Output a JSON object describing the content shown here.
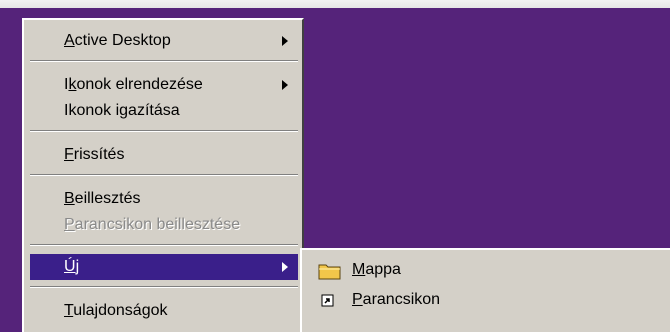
{
  "colors": {
    "desktop": "#55237a",
    "menu_bg": "#d4d0c8",
    "selection": "#3a1f8a",
    "disabled_text": "#8a8a8a"
  },
  "context_menu": {
    "items": [
      {
        "label_first": "A",
        "label_rest": "ctive Desktop",
        "has_submenu": true
      },
      {
        "label_first": "I",
        "label_under": "k",
        "label_rest": "onok elrendezése",
        "has_submenu": true
      },
      {
        "label": "Ikonok igazítása"
      },
      {
        "label_first": "F",
        "label_rest": "rissítés"
      },
      {
        "label_first": "B",
        "label_rest": "eillesztés"
      },
      {
        "label_first": "P",
        "label_rest": "arancsikon beillesztése",
        "disabled": true
      },
      {
        "label_first": "Ú",
        "label_rest": "j",
        "has_submenu": true,
        "selected": true
      },
      {
        "label_first": "T",
        "label_rest": "ulajdonságok"
      }
    ]
  },
  "submenu": {
    "items": [
      {
        "label_first": "M",
        "label_rest": "appa",
        "icon": "folder-icon"
      },
      {
        "label_first": "P",
        "label_rest": "arancsikon",
        "icon": "shortcut-icon"
      }
    ]
  }
}
